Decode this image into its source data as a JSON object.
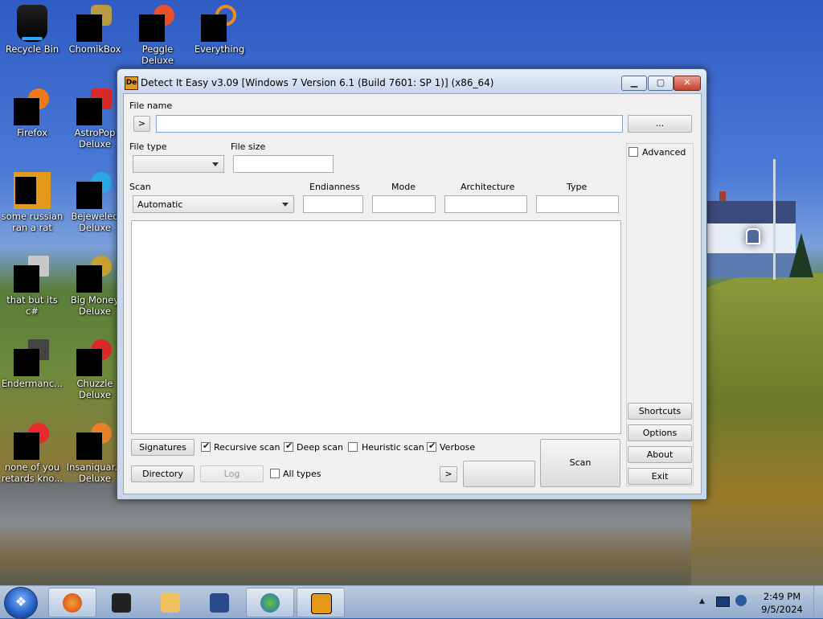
{
  "desktop": {
    "icons": [
      {
        "label": "Recycle Bin"
      },
      {
        "label": "ChomikBox"
      },
      {
        "label": "Peggle Deluxe"
      },
      {
        "label": "Everything"
      },
      {
        "label": "Firefox"
      },
      {
        "label": "AstroPop Deluxe"
      },
      {
        "label": "some russian ran a rat"
      },
      {
        "label": "Bejeweled Deluxe"
      },
      {
        "label": "that but its c#"
      },
      {
        "label": "Big Money Deluxe"
      },
      {
        "label": "Endermanc..."
      },
      {
        "label": "Chuzzle Deluxe"
      },
      {
        "label": "none of you retards kno..."
      },
      {
        "label": "Insaniquar... Deluxe"
      }
    ]
  },
  "window": {
    "icon_text": "De",
    "title": "Detect It Easy v3.09 [Windows 7 Version 6.1 (Build 7601: SP 1)] (x86_64)",
    "minimize_icon": "minimize-icon",
    "maximize_icon": "maximize-icon",
    "close_icon": "close-icon",
    "close_glyph": "✕"
  },
  "form": {
    "file_name_label": "File name",
    "file_name_value": "",
    "arrow_button": ">",
    "browse_button": "...",
    "file_type_label": "File type",
    "file_type_value": "",
    "file_size_label": "File size",
    "file_size_value": "",
    "scan_label": "Scan",
    "scan_value": "Automatic",
    "endianness_label": "Endianness",
    "endianness_value": "",
    "mode_label": "Mode",
    "mode_value": "",
    "architecture_label": "Architecture",
    "architecture_value": "",
    "type_label": "Type",
    "type_value": "",
    "advanced_label": "Advanced",
    "advanced_checked": false
  },
  "bottom": {
    "signatures_button": "Signatures",
    "directory_button": "Directory",
    "log_button": "Log",
    "recursive_scan_label": "Recursive scan",
    "recursive_scan_checked": true,
    "deep_scan_label": "Deep scan",
    "deep_scan_checked": true,
    "heuristic_scan_label": "Heuristic scan",
    "heuristic_scan_checked": false,
    "verbose_label": "Verbose",
    "verbose_checked": true,
    "all_types_label": "All types",
    "all_types_checked": false,
    "more_button": ">",
    "scan_button": "Scan"
  },
  "side": {
    "shortcuts_button": "Shortcuts",
    "options_button": "Options",
    "about_button": "About",
    "exit_button": "Exit"
  },
  "taskbar": {
    "start_icon": "windows-start-icon",
    "items": [
      "firefox-icon",
      "terminal-icon",
      "media-player-icon",
      "virtualbox-icon",
      "download-manager-icon",
      "detect-it-easy-icon"
    ],
    "time": "2:49 PM",
    "date": "9/5/2024"
  }
}
